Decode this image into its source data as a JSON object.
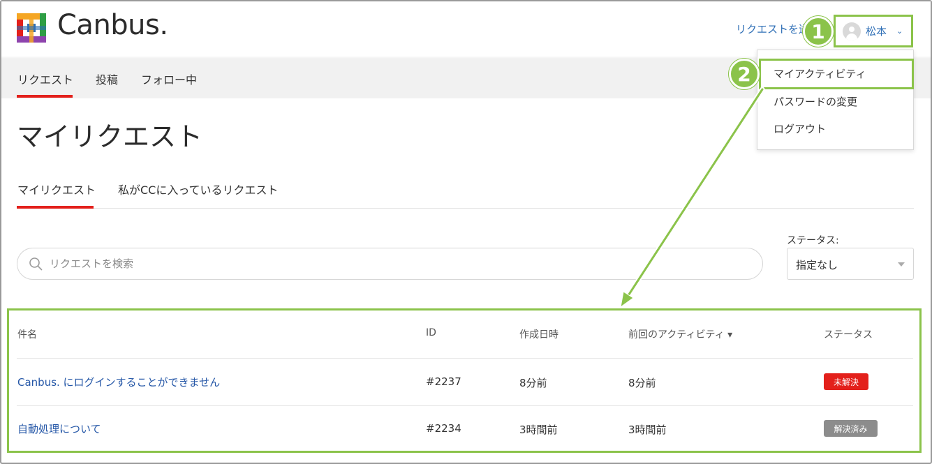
{
  "app": {
    "logo_text": "Canbus."
  },
  "header": {
    "top_link": "リクエストを送信",
    "user_name": "松本",
    "nav": [
      "リクエスト",
      "投稿",
      "フォロー中"
    ]
  },
  "user_dropdown": {
    "items": [
      "マイアクティビティ",
      "パスワードの変更",
      "ログアウト"
    ]
  },
  "callouts": {
    "badge_1": "1",
    "badge_2": "2"
  },
  "page": {
    "title": "マイリクエスト",
    "tabs": [
      "マイリクエスト",
      "私がCCに入っているリクエスト"
    ]
  },
  "search": {
    "placeholder": "リクエストを検索"
  },
  "filter": {
    "label": "ステータス:",
    "value": "指定なし"
  },
  "table": {
    "headers": [
      "件名",
      "ID",
      "作成日時",
      "前回のアクティビティ ▾",
      "ステータス"
    ],
    "rows": [
      {
        "subject": "Canbus. にログインすることができません",
        "id": "#2237",
        "created": "8分前",
        "last_activity": "8分前",
        "status": "未解決"
      },
      {
        "subject": "自動処理について",
        "id": "#2234",
        "created": "3時間前",
        "last_activity": "3時間前",
        "status": "解決済み"
      }
    ]
  },
  "colors": {
    "accent_red": "#e3201b",
    "link_blue": "#2f6fb6",
    "highlight_green": "#8bc34a",
    "status_open": "#e3201b",
    "status_solved": "#8c8c8c"
  }
}
